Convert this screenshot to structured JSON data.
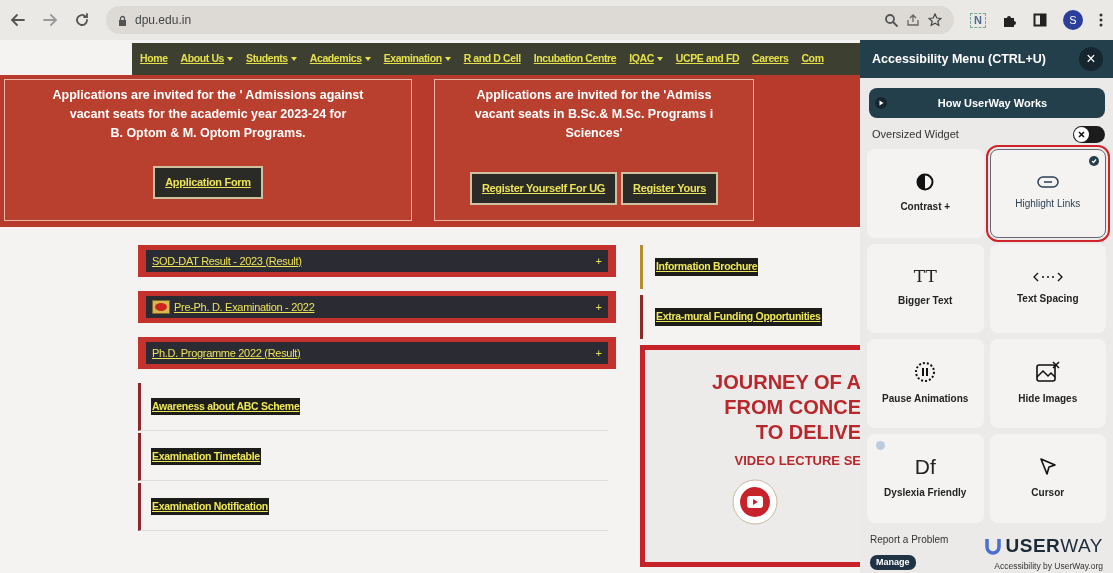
{
  "browser": {
    "url": "dpu.edu.in",
    "profile_initial": "S",
    "extension_label": "N"
  },
  "nav": [
    {
      "label": "Home",
      "has_dropdown": false
    },
    {
      "label": "About Us",
      "has_dropdown": true
    },
    {
      "label": "Students",
      "has_dropdown": true
    },
    {
      "label": "Academics",
      "has_dropdown": true
    },
    {
      "label": "Examination",
      "has_dropdown": true
    },
    {
      "label": "R and D Cell",
      "has_dropdown": false
    },
    {
      "label": "Incubation Centre",
      "has_dropdown": false
    },
    {
      "label": "IQAC",
      "has_dropdown": true
    },
    {
      "label": "UCPE and FD",
      "has_dropdown": false
    },
    {
      "label": "Careers",
      "has_dropdown": false
    },
    {
      "label": "Com",
      "has_dropdown": false
    }
  ],
  "banners": [
    {
      "lines": [
        "Applications are invited for the ' Admissions against",
        "vacant seats for the academic year 2023-24 for",
        "B. Optom & M. Optom Programs."
      ],
      "buttons": [
        "Application Form"
      ]
    },
    {
      "lines": [
        "Applications are invited for the 'Admiss",
        "vacant seats in B.Sc.& M.Sc. Programs i",
        "Sciences'"
      ],
      "buttons": [
        "Register Yourself For UG",
        "Register Yours"
      ]
    }
  ],
  "accordions": [
    {
      "label": "SOD-DAT Result - 2023 (Result)",
      "new_icon": false,
      "toggle": "+"
    },
    {
      "label": "Pre-Ph. D. Examination - 2022",
      "new_icon": true,
      "toggle": "+"
    },
    {
      "label": "Ph.D. Programme 2022 (Result)",
      "new_icon": false,
      "toggle": "+"
    }
  ],
  "links": [
    {
      "label": "Awareness about ABC Scheme"
    },
    {
      "label": "Examination Timetable"
    },
    {
      "label": "Examination Notification"
    }
  ],
  "side_links": [
    {
      "label": "Information Brochure"
    },
    {
      "label": "Extra-mural Funding Opportunities"
    }
  ],
  "video_card": {
    "title_lines": [
      "JOURNEY OF A",
      "FROM CONCE",
      "TO DELIVE"
    ],
    "subtitle": "VIDEO LECTURE SE"
  },
  "accessibility_panel": {
    "title": "Accessibility Menu (CTRL+U)",
    "close": "×",
    "how_button": "How UserWay Works",
    "oversized_widget": {
      "label": "Oversized Widget",
      "on": false
    },
    "tiles": [
      {
        "kind": "contrast",
        "label": "Contrast +",
        "selected": false
      },
      {
        "kind": "link",
        "label": "Highlight Links",
        "selected": true
      },
      {
        "kind": "text",
        "label": "Bigger Text",
        "icon_text": "TT",
        "selected": false
      },
      {
        "kind": "spacing",
        "label": "Text Spacing",
        "selected": false
      },
      {
        "kind": "pause",
        "label": "Pause Animations",
        "selected": false
      },
      {
        "kind": "image",
        "label": "Hide Images",
        "selected": false
      },
      {
        "kind": "dyslexia",
        "label": "Dyslexia Friendly",
        "icon_text": "Df",
        "selected": false
      },
      {
        "kind": "cursor",
        "label": "Cursor",
        "selected": false
      }
    ],
    "report": "Report a Problem",
    "manage": "Manage",
    "brand": "**USER**WAY",
    "brand_caption": "Accessibility by UserWay.org"
  }
}
